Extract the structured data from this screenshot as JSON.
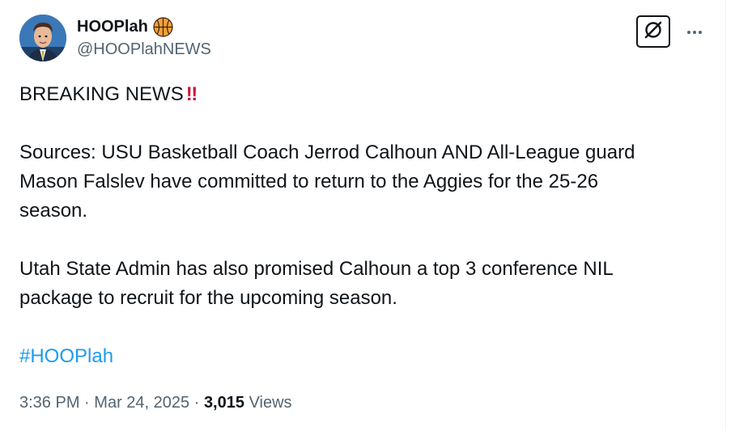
{
  "author": {
    "display_name": "HOOPlah",
    "badge_icon": "basketball-icon",
    "handle": "@HOOPlahNEWS"
  },
  "post": {
    "headline": "BREAKING NEWS",
    "headline_emoji": "‼",
    "lines": [
      "Sources: USU Basketball Coach Jerrod Calhoun AND All-League guard",
      "Mason Falslev have committed to return to the Aggies for the 25-26",
      "season.",
      "Utah State Admin has also promised Calhoun a top 3 conference NIL",
      "package to recruit for the upcoming season."
    ],
    "hashtag": "#HOOPlah"
  },
  "meta": {
    "time": "3:36 PM",
    "separator": "·",
    "date": "Mar 24, 2025",
    "views_count": "3,015",
    "views_label": "Views"
  },
  "actions": {
    "grok_icon": "grok-icon",
    "more_icon": "more-dots-icon"
  },
  "colors": {
    "text": "#0f1419",
    "secondary": "#536471",
    "link": "#1d9bf0",
    "alert": "#d0133a"
  }
}
